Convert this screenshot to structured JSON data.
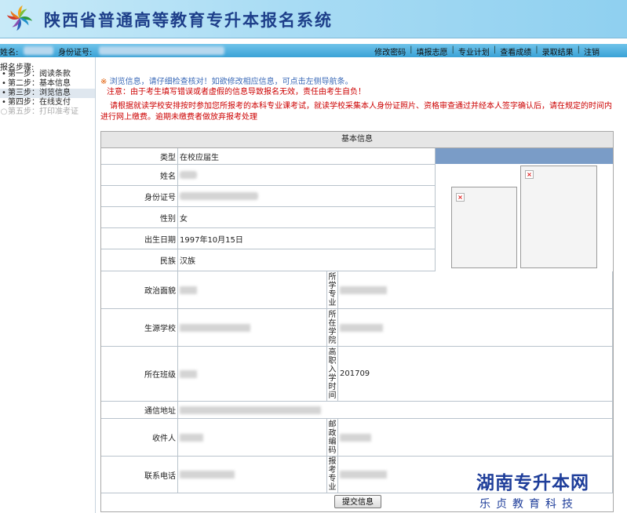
{
  "header": {
    "title": "陕西省普通高等教育专升本报名系统"
  },
  "topbar": {
    "name_label": "姓名:",
    "id_label": "身份证号:",
    "nav": [
      "修改密码",
      "填报志愿",
      "专业计划",
      "查看成绩",
      "录取结果",
      "注销"
    ],
    "separator": "|"
  },
  "sidebar": {
    "title": "报名步骤:",
    "bullet": "•",
    "bullet_disabled": "○",
    "steps": [
      {
        "label": "第一步：阅读条款"
      },
      {
        "label": "第二步：基本信息"
      },
      {
        "label": "第三步：浏览信息"
      },
      {
        "label": "第四步：在线支付"
      },
      {
        "label": "第五步：打印准考证"
      }
    ]
  },
  "notices": {
    "mark": "※",
    "line1": "浏览信息，请仔细检查核对！如欲修改相应信息，可点击左侧导航条。",
    "line2": "注意：由于考生填写错误或者虚假的信息导致报名无效，责任由考生自负！",
    "line3": "请根据就读学校安排按时参加您所报考的本科专业课考试，就读学校采集本人身份证照片、资格审查通过并经本人签字确认后，请在规定的时间内进行网上缴费。逾期未缴费者做放弃报考处理"
  },
  "form": {
    "heading": "基本信息",
    "type_label": "类型",
    "type_value": "在校应届生",
    "name_label": "姓名",
    "id_label": "身份证号",
    "gender_label": "性别",
    "gender_value": "女",
    "birth_label": "出生日期",
    "birth_value": "1997年10月15日",
    "ethnic_label": "民族",
    "ethnic_value": "汉族",
    "political_label": "政治面貌",
    "major_label": "所学专业",
    "school_label": "生源学校",
    "college_label": "所在学院",
    "class_label": "所在班级",
    "enroll_label": "高职入学时间",
    "enroll_value": "201709",
    "address_label": "通信地址",
    "recipient_label": "收件人",
    "postcode_label": "邮政编码",
    "phone_label": "联系电话",
    "exam_major_label": "报考专业",
    "submit": "提交信息",
    "photo_icon": "broken-image-icon"
  },
  "watermark": {
    "title": "湖南专升本网",
    "subtitle": "乐贞教育科技"
  }
}
